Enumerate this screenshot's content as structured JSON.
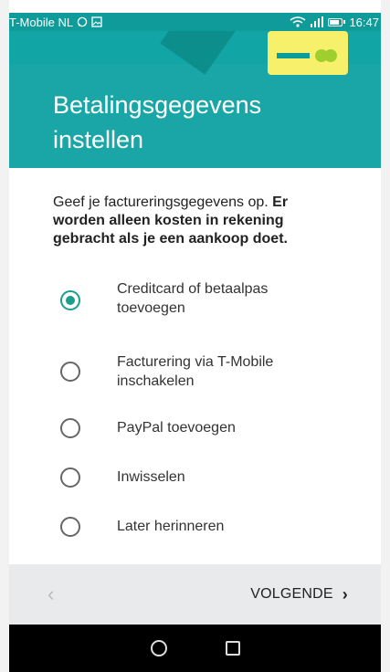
{
  "statusbar": {
    "carrier": "T-Mobile NL",
    "time": "16:47",
    "icons": [
      "whatsapp-icon",
      "image-icon",
      "wifi-icon",
      "signal-icon",
      "battery-icon"
    ]
  },
  "header": {
    "title": "Betalingsgegevens instellen",
    "accent_color": "#1aa6a6",
    "card_color": "#f7f06b"
  },
  "intro": {
    "normal": "Geef je factureringsgegevens op. ",
    "bold": "Er worden alleen kosten in rekening gebracht als je een aankoop doet."
  },
  "options": [
    {
      "label": "Creditcard of betaalpas toevoegen",
      "selected": true
    },
    {
      "label": "Facturering via T-Mobile inschakelen",
      "selected": false
    },
    {
      "label": "PayPal toevoegen",
      "selected": false
    },
    {
      "label": "Inwisselen",
      "selected": false
    },
    {
      "label": "Later herinneren",
      "selected": false
    }
  ],
  "nav": {
    "back_glyph": "‹",
    "next_label": "VOLGENDE",
    "next_glyph": "›"
  }
}
